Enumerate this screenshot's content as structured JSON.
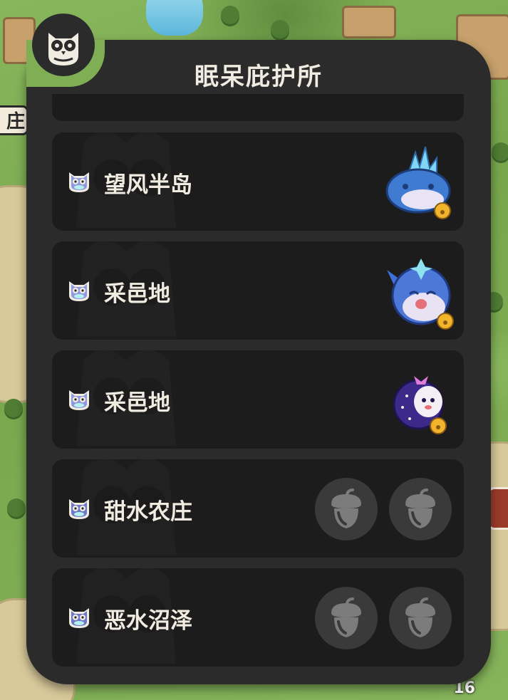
{
  "screen": {
    "title": "眠呆庇护所",
    "counter": "16"
  },
  "map": {
    "label_fragment": "庄区"
  },
  "entries": [
    {
      "label": "望风半岛",
      "icon": "owl-shelter-icon",
      "icon_color": "#8f9ade",
      "status": "occupied",
      "creature": "crystal-whale-creature"
    },
    {
      "label": "采邑地",
      "icon": "owl-shelter-icon",
      "icon_color": "#8f9ade",
      "status": "occupied",
      "creature": "blue-fox-creature"
    },
    {
      "label": "采邑地",
      "icon": "owl-shelter-icon",
      "icon_color": "#8f9ade",
      "status": "occupied",
      "creature": "purple-ghost-creature"
    },
    {
      "label": "甜水农庄",
      "icon": "owl-shelter-icon",
      "icon_color": "#6f78c8",
      "status": "empty",
      "slots": [
        "acorn-icon",
        "acorn-icon"
      ]
    },
    {
      "label": "恶水沼泽",
      "icon": "owl-shelter-icon",
      "icon_color": "#6f78c8",
      "status": "empty",
      "slots": [
        "acorn-icon",
        "acorn-icon"
      ]
    }
  ],
  "colors": {
    "panel": "#2b2b2c",
    "card": "#1c1c1d",
    "text": "#f1ece1",
    "slot": "#3a3a3b",
    "acorn": "#7c7c7c"
  }
}
